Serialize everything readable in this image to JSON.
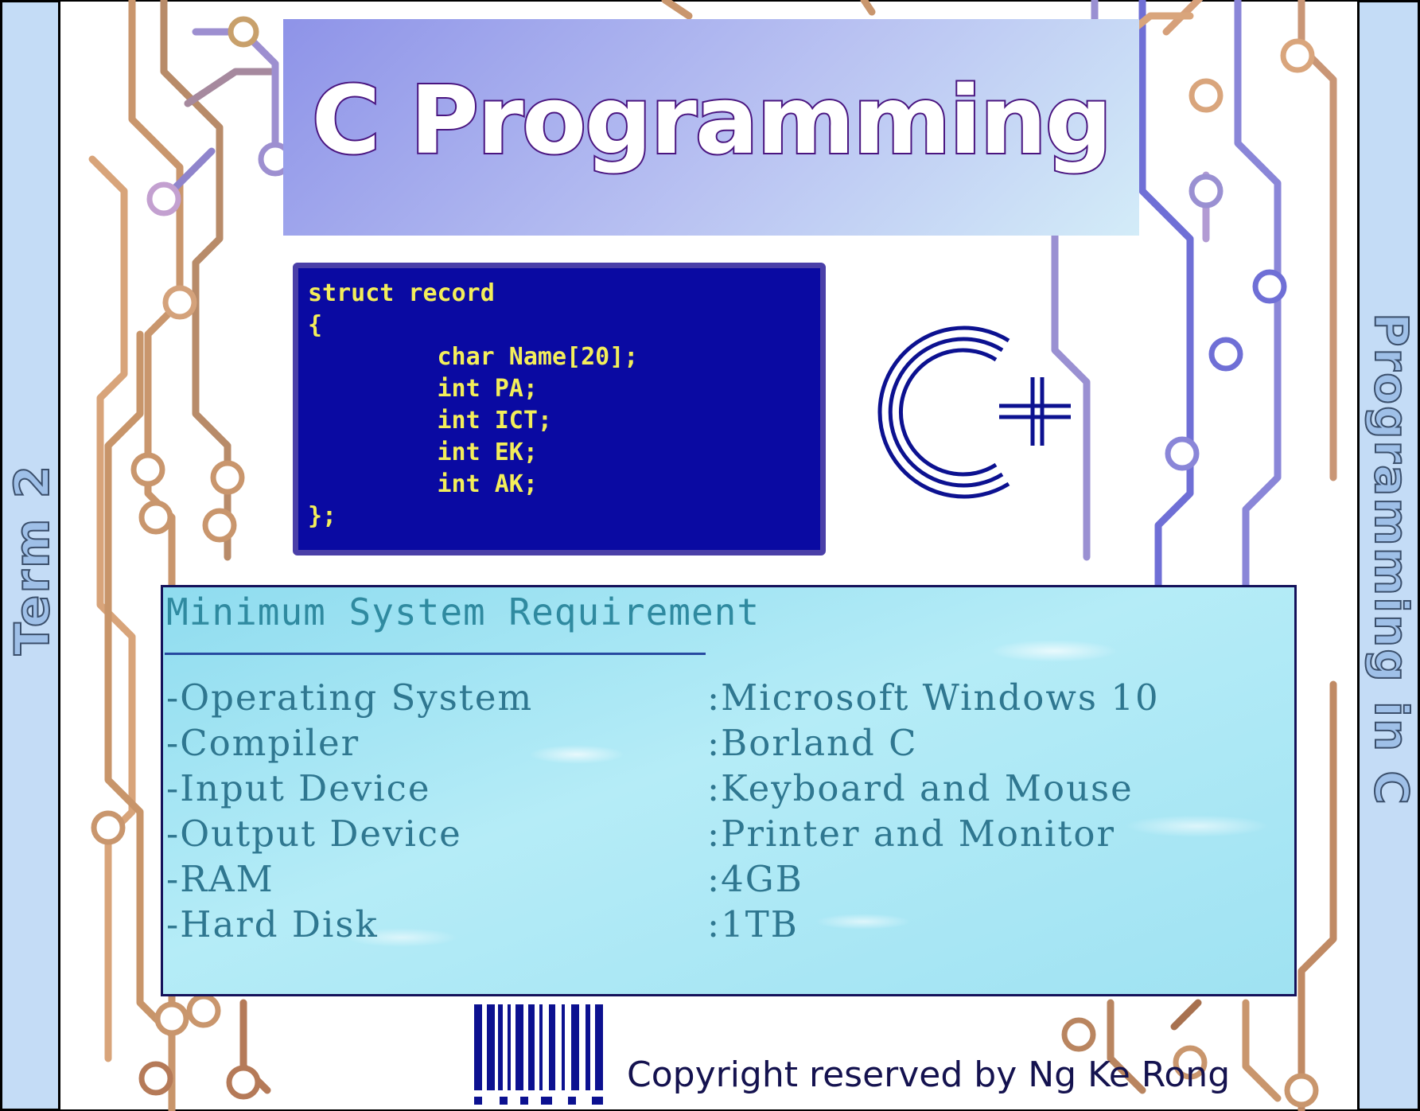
{
  "spine_left": {
    "text": "Term 2"
  },
  "spine_right": {
    "text": "Programming in C"
  },
  "banner": {
    "title": "C Programming"
  },
  "code": {
    "lines": [
      "struct record",
      "{",
      "        char Name[20];",
      "        int PA;",
      "        int ICT;",
      "        int EK;",
      "        int AK;",
      "};"
    ]
  },
  "logo": {
    "icon": "c-plus-logo-icon"
  },
  "requirements": {
    "heading": "Minimum System Requirement",
    "items": [
      {
        "label": "-Operating System",
        "value": ":Microsoft Windows 10"
      },
      {
        "label": "-Compiler",
        "value": ":Borland C"
      },
      {
        "label": "-Input Device",
        "value": ":Keyboard and Mouse"
      },
      {
        "label": "-Output Device",
        "value": ":Printer and Monitor"
      },
      {
        "label": "-RAM",
        "value": ":4GB"
      },
      {
        "label": "-Hard Disk",
        "value": ":1TB"
      }
    ]
  },
  "barcode": {
    "icon": "barcode-icon"
  },
  "footer": {
    "copyright": "Copyright reserved by Ng Ke Rong"
  },
  "colors": {
    "spine": "#c4dcf6",
    "code_bg": "#0a0aa2",
    "code_text": "#f3ee5a",
    "logo": "#0c1190",
    "panel": "#a9e6f4"
  }
}
